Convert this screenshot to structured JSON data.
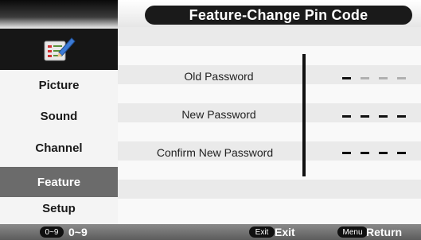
{
  "header": {
    "title": "Feature-Change Pin Code"
  },
  "sidebar": {
    "items": [
      {
        "label": "Picture"
      },
      {
        "label": "Sound"
      },
      {
        "label": "Channel"
      },
      {
        "label": "Feature",
        "active": true
      },
      {
        "label": "Setup"
      }
    ]
  },
  "form": {
    "old_password_label": "Old Password",
    "new_password_label": "New Password",
    "confirm_password_label": "Confirm New Password",
    "old_password_value": "- - - -",
    "new_password_value": "- - - -",
    "confirm_password_value": "- - - -"
  },
  "footer": {
    "digits_key": "0~9",
    "digits_label": "0~9",
    "exit_key": "Exit",
    "exit_label": "Exit",
    "menu_key": "Menu",
    "return_label": "Return"
  },
  "colors": {
    "active_item": "#6b6b6b",
    "title_pill": "#1a1a1a",
    "footer": "#6e6e6e"
  }
}
